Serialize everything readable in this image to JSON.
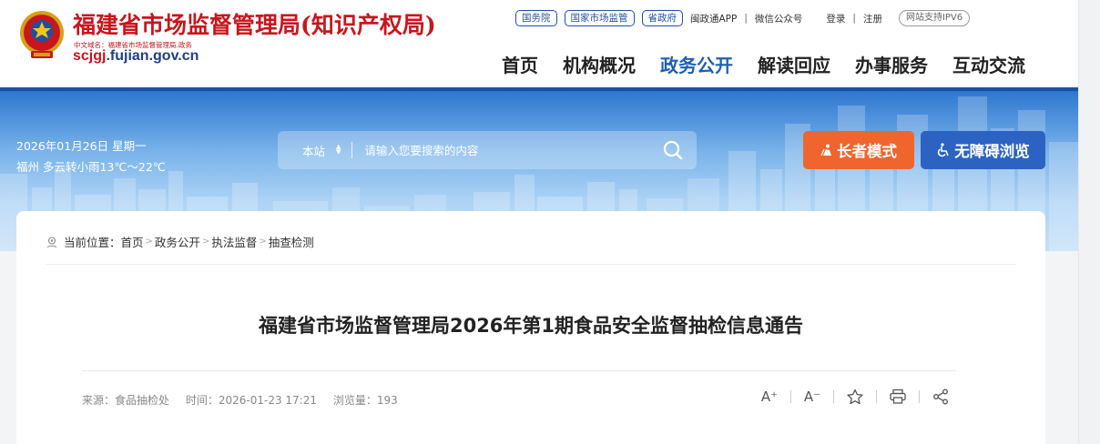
{
  "header": {
    "site_title": "福建省市场监督管理局(知识产权局)",
    "cn_domain": "中文域名：福建省市场监督管理局.政务",
    "en_domain_prefix": "scjgj",
    "en_domain_suffix": ".fujian.gov.cn",
    "top_links": {
      "guowuyuan": "国务院",
      "state_admin": "国家市场监管",
      "provincial_gov": "省政府",
      "mintong_app": "闽政通APP",
      "wechat": "微信公众号",
      "login": "登录",
      "register": "注册",
      "ipv6": "网站支持IPV6"
    },
    "nav": [
      "首页",
      "机构概况",
      "政务公开",
      "解读回应",
      "办事服务",
      "互动交流"
    ],
    "nav_active_index": 2
  },
  "banner": {
    "date": "2026年01月26日 星期一",
    "weather": "福州 多云转小雨13℃～22℃",
    "search_scope": "本站",
    "search_placeholder": "请输入您要搜索的内容",
    "elder_mode": "长者模式",
    "accessibility": "无障碍浏览"
  },
  "breadcrumb": {
    "prefix": "当前位置：",
    "items": [
      "首页",
      "政务公开",
      "执法监督",
      "抽查检测"
    ]
  },
  "article": {
    "title": "福建省市场监督管理局2026年第1期食品安全监督抽检信息通告",
    "source": "来源：食品抽检处",
    "time": "时间：2026-01-23 17:21",
    "views": "浏览量：193"
  },
  "tools": {
    "font_larger": "A⁺",
    "font_smaller": "A⁻"
  },
  "colors": {
    "brand_red": "#c8161d",
    "brand_blue": "#1d5fb5",
    "elder_orange": "#f0652d",
    "access_blue": "#2c63c3"
  }
}
